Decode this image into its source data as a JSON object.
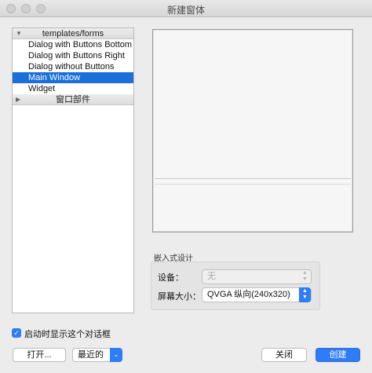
{
  "window": {
    "title": "新建窗体"
  },
  "templates": {
    "category_forms": "templates/forms",
    "items": [
      "Dialog with Buttons Bottom",
      "Dialog with Buttons Right",
      "Dialog without Buttons",
      "Main Window",
      "Widget"
    ],
    "selected": "Main Window",
    "category_widgets": "窗口部件"
  },
  "embedded": {
    "group_label": "嵌入式设计",
    "device_label": "设备：",
    "device_value": "无",
    "screen_size_label": "屏幕大小：",
    "screen_size_value": "QVGA 纵向(240x320)"
  },
  "startup": {
    "show_dialog_label": "启动时显示这个对话框",
    "checked": true
  },
  "buttons": {
    "open": "打开...",
    "recent": "最近的",
    "close": "关闭",
    "create": "创建"
  },
  "colors": {
    "accent": "#2e7cf6",
    "selection": "#1a6fd9"
  },
  "icons": {
    "expanded": "triangle-down",
    "collapsed": "triangle-right",
    "checkbox": "checkmark",
    "dropdown": "up-down-chevron"
  }
}
